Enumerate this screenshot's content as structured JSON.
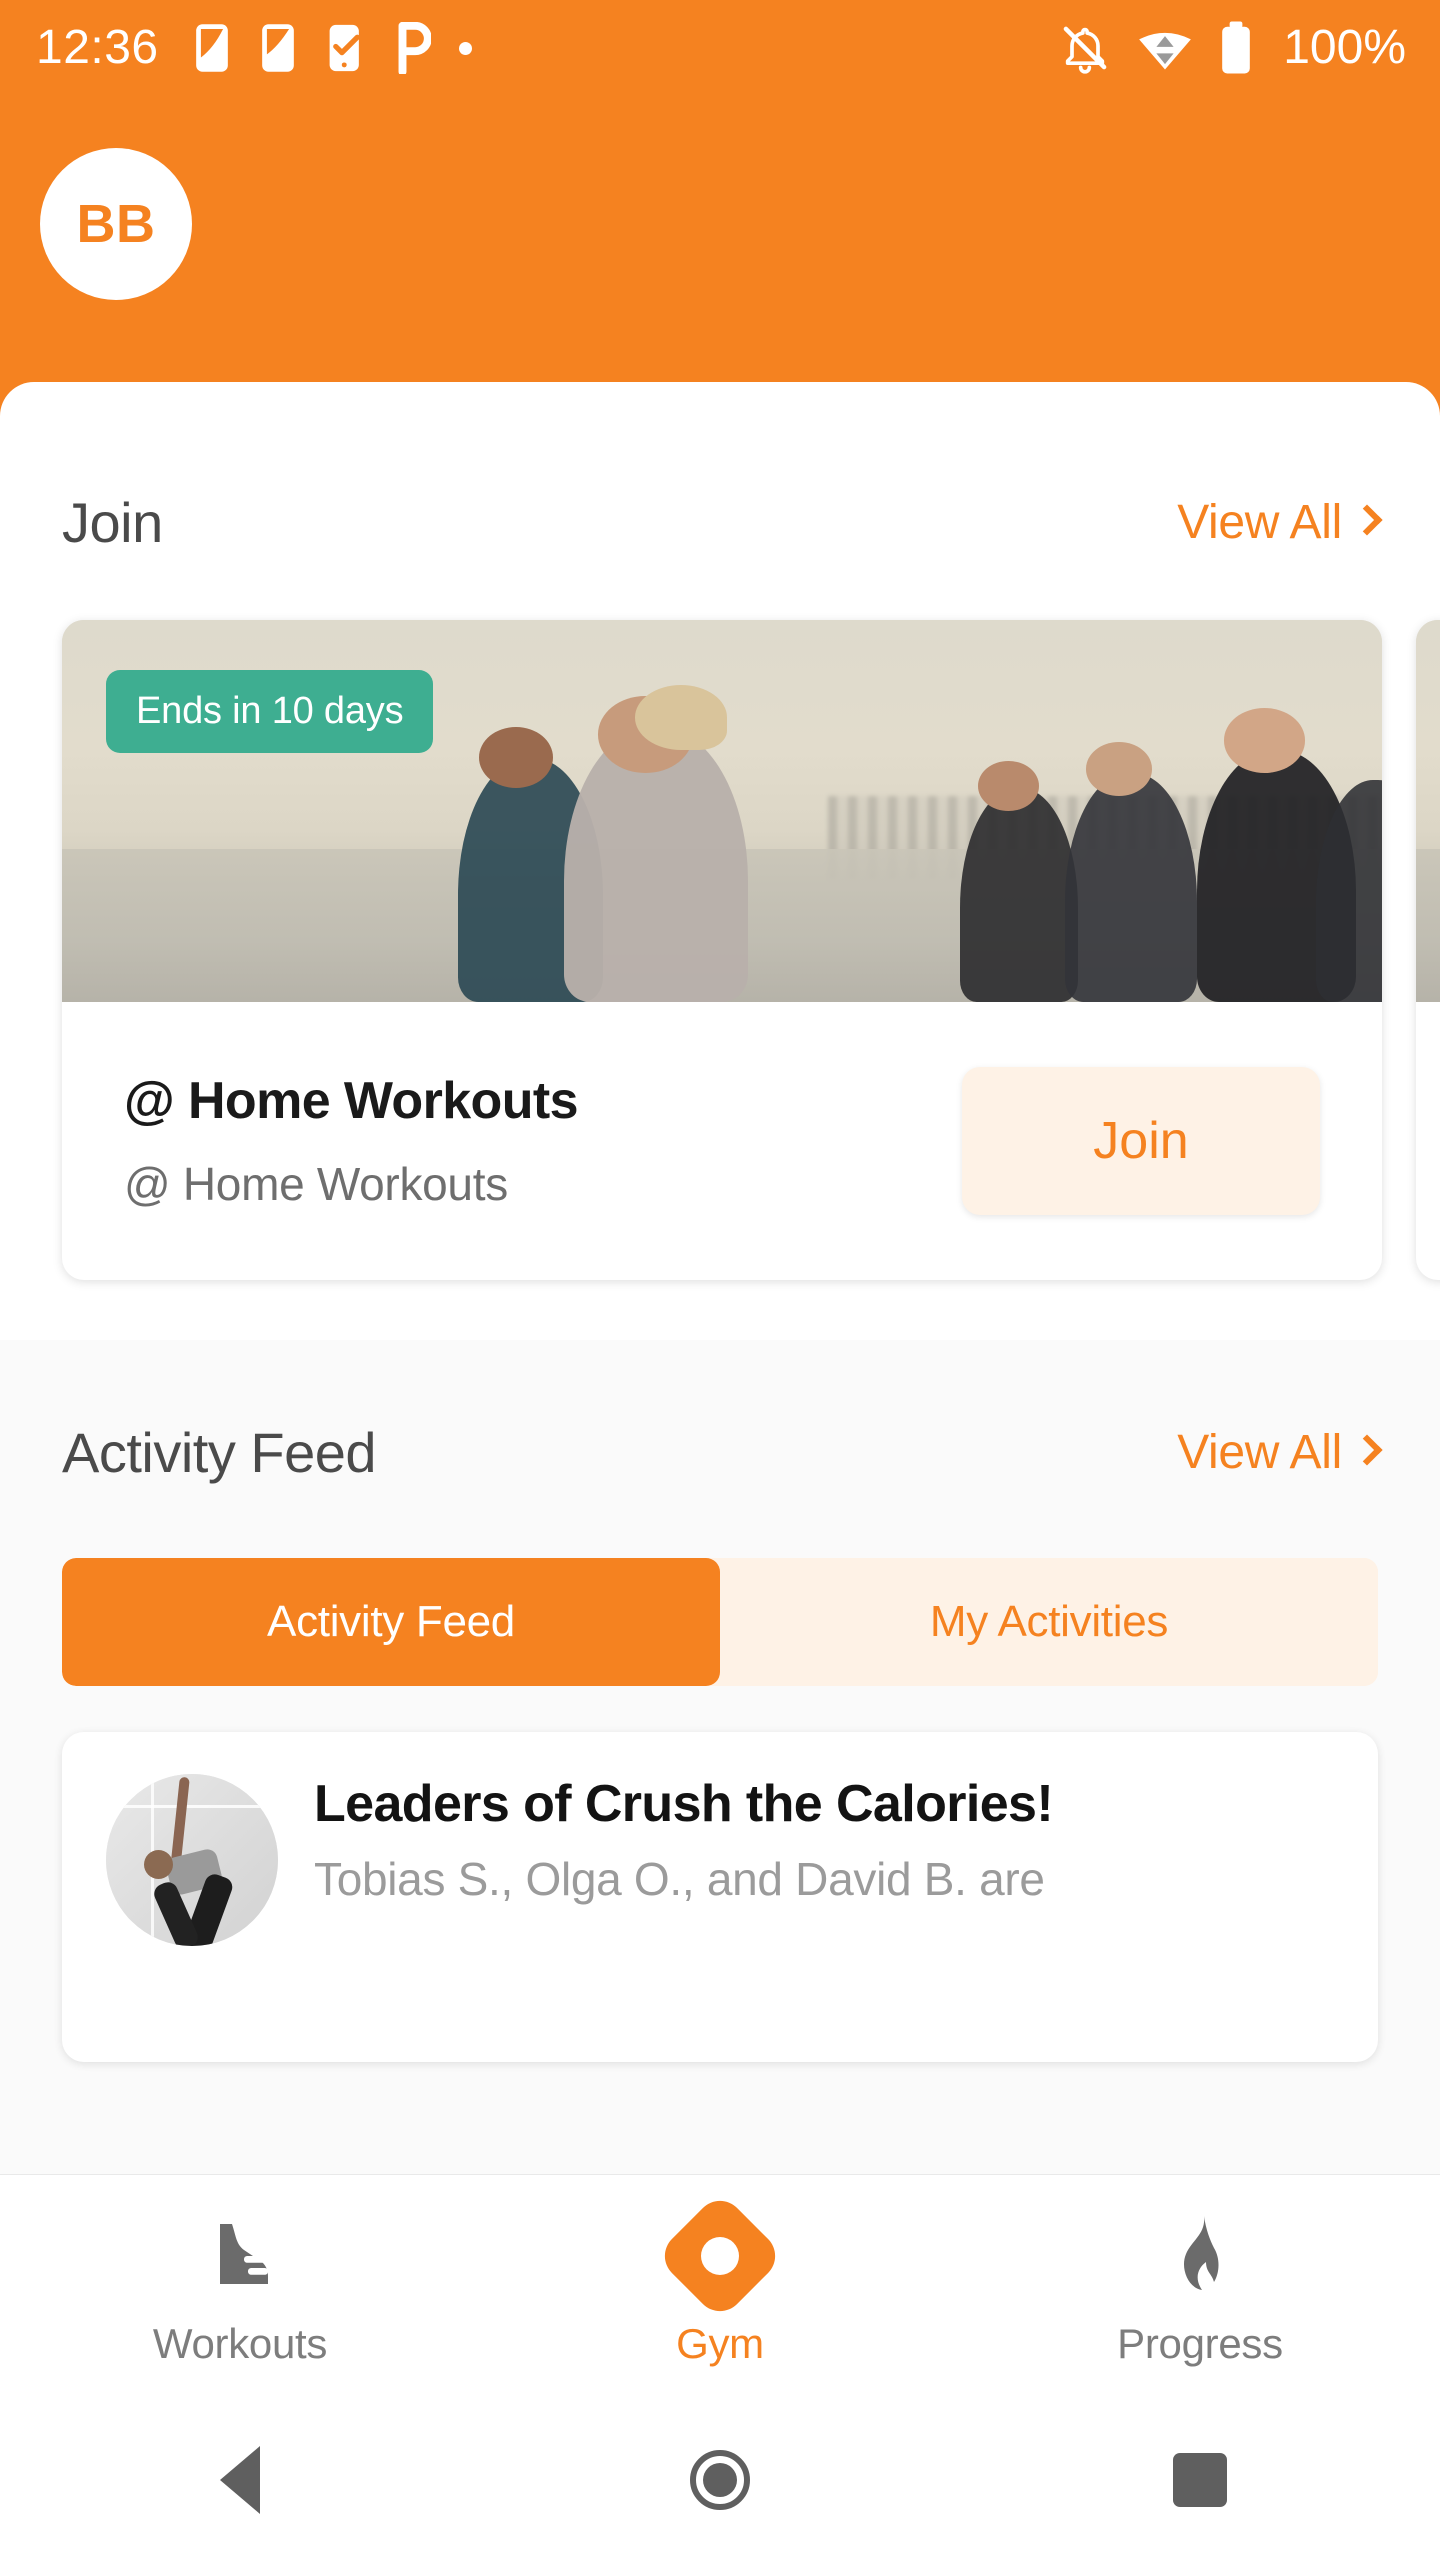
{
  "theme": {
    "primary": "#F58220",
    "primary_tint": "#FEF2E6",
    "badge_green": "#3EAE91",
    "text_dark": "#1a1a1a",
    "text_muted": "#9b9b9b"
  },
  "status_bar": {
    "time": "12:36",
    "battery_percent": "100%",
    "left_icons": [
      "sim-card-icon",
      "sim-card-icon",
      "phone-check-icon",
      "p-app-icon",
      "dot-indicator-icon"
    ],
    "right_icons": [
      "notifications-off-icon",
      "wifi-data-icon",
      "battery-full-icon"
    ]
  },
  "header": {
    "avatar_initials": "BB"
  },
  "join_section": {
    "title": "Join",
    "view_all_label": "View All",
    "cards": [
      {
        "badge": "Ends in 10 days",
        "title": "@ Home Workouts",
        "subtitle": "@ Home Workouts",
        "action_label": "Join",
        "hero_alt": "group-running-on-beach-photo"
      }
    ]
  },
  "activity_section": {
    "title": "Activity Feed",
    "view_all_label": "View All",
    "tabs": [
      {
        "label": "Activity Feed",
        "active": true
      },
      {
        "label": "My Activities",
        "active": false
      }
    ],
    "items": [
      {
        "title": "Leaders of Crush the Calories!",
        "subtitle": "Tobias S., Olga O., and David B. are",
        "thumb_alt": "yoga-stretch-pose-photo"
      }
    ]
  },
  "bottom_nav": {
    "items": [
      {
        "label": "Workouts",
        "icon": "running-shoe-icon",
        "active": false
      },
      {
        "label": "Gym",
        "icon": "gym-diamond-icon",
        "active": true
      },
      {
        "label": "Progress",
        "icon": "flame-icon",
        "active": false
      }
    ]
  },
  "system_nav": {
    "back": "back-triangle-icon",
    "home": "home-circle-icon",
    "recents": "recents-square-icon"
  }
}
